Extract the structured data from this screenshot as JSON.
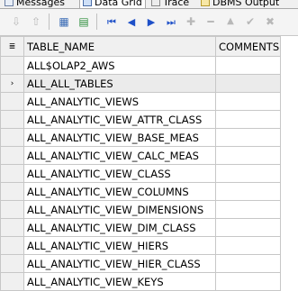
{
  "tabs": [
    {
      "label": "Messages",
      "icon": "messages-icon",
      "active": false
    },
    {
      "label": "Data Grid",
      "icon": "data-grid-icon",
      "active": true
    },
    {
      "label": "Trace",
      "icon": "trace-icon",
      "active": false
    },
    {
      "label": "DBMS Output",
      "icon": "dbms-output-icon",
      "active": false
    }
  ],
  "toolbar": {
    "buttons": [
      {
        "name": "export-icon",
        "glyph": "⇩",
        "enabled": false
      },
      {
        "name": "import-icon",
        "glyph": "⇧",
        "enabled": false
      },
      {
        "name": "grid-view-icon",
        "glyph": "▦",
        "enabled": true
      },
      {
        "name": "record-view-icon",
        "glyph": "▤",
        "enabled": true
      },
      {
        "name": "first-record-icon",
        "glyph": "⏮",
        "enabled": true
      },
      {
        "name": "prior-record-icon",
        "glyph": "◀",
        "enabled": true
      },
      {
        "name": "next-record-icon",
        "glyph": "▶",
        "enabled": true
      },
      {
        "name": "last-record-icon",
        "glyph": "⏭",
        "enabled": true
      },
      {
        "name": "insert-record-icon",
        "glyph": "✚",
        "enabled": false
      },
      {
        "name": "delete-record-icon",
        "glyph": "━",
        "enabled": false
      },
      {
        "name": "edit-record-icon",
        "glyph": "▲",
        "enabled": false
      },
      {
        "name": "post-edit-icon",
        "glyph": "✔",
        "enabled": false
      },
      {
        "name": "cancel-edit-icon",
        "glyph": "✖",
        "enabled": false
      }
    ]
  },
  "grid": {
    "indicator_header_icon": "≣",
    "current_row_marker": "›",
    "columns": [
      "TABLE_NAME",
      "COMMENTS"
    ],
    "current_row": 1,
    "rows": [
      [
        "ALL$OLAP2_AWS",
        ""
      ],
      [
        "ALL_ALL_TABLES",
        ""
      ],
      [
        "ALL_ANALYTIC_VIEWS",
        ""
      ],
      [
        "ALL_ANALYTIC_VIEW_ATTR_CLASS",
        ""
      ],
      [
        "ALL_ANALYTIC_VIEW_BASE_MEAS",
        ""
      ],
      [
        "ALL_ANALYTIC_VIEW_CALC_MEAS",
        ""
      ],
      [
        "ALL_ANALYTIC_VIEW_CLASS",
        ""
      ],
      [
        "ALL_ANALYTIC_VIEW_COLUMNS",
        ""
      ],
      [
        "ALL_ANALYTIC_VIEW_DIMENSIONS",
        ""
      ],
      [
        "ALL_ANALYTIC_VIEW_DIM_CLASS",
        ""
      ],
      [
        "ALL_ANALYTIC_VIEW_HIERS",
        ""
      ],
      [
        "ALL_ANALYTIC_VIEW_HIER_CLASS",
        ""
      ],
      [
        "ALL_ANALYTIC_VIEW_KEYS",
        ""
      ]
    ]
  }
}
